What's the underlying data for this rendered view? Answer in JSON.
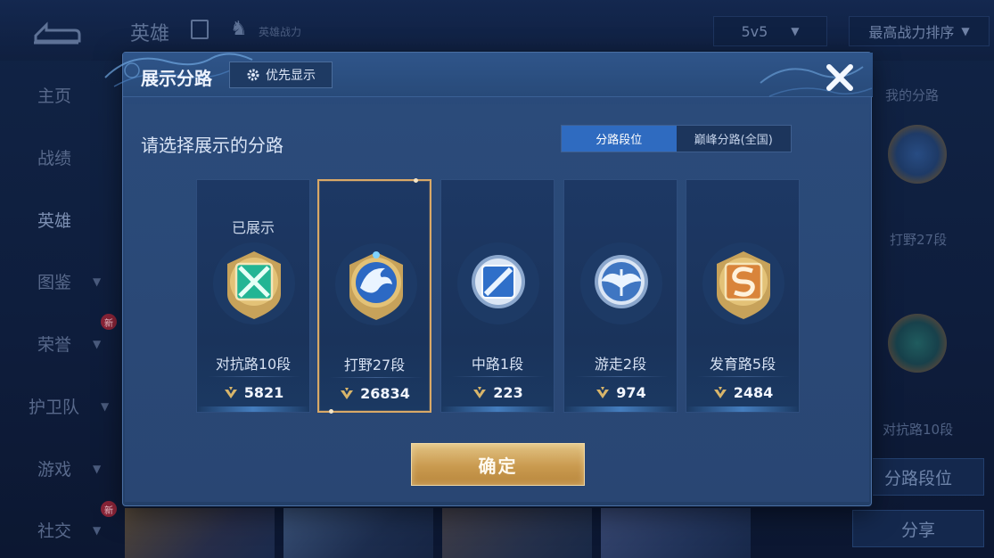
{
  "background": {
    "title": "英雄",
    "subtitle": "英雄战力",
    "mode_select": "5v5",
    "sort_select": "最高战力排序",
    "sidebar": [
      {
        "label": "主页",
        "has_chevron": false,
        "is_new": false
      },
      {
        "label": "战绩",
        "has_chevron": false,
        "is_new": false
      },
      {
        "label": "英雄",
        "has_chevron": false,
        "is_new": false
      },
      {
        "label": "图鉴",
        "has_chevron": true,
        "is_new": false
      },
      {
        "label": "荣誉",
        "has_chevron": true,
        "is_new": true
      },
      {
        "label": "护卫队",
        "has_chevron": true,
        "is_new": false
      },
      {
        "label": "游戏",
        "has_chevron": true,
        "is_new": false
      },
      {
        "label": "社交",
        "has_chevron": true,
        "is_new": true
      }
    ],
    "new_tag": "新",
    "right_panel": {
      "header": "我的分路",
      "lane1_label": "打野27段",
      "lane2_label": "对抗路10段",
      "lane_rank_button": "分路段位",
      "share_button": "分享"
    }
  },
  "modal": {
    "title": "展示分路",
    "priority_button": "优先显示",
    "section_title": "请选择展示的分路",
    "tabs": [
      {
        "label": "分路段位",
        "active": true
      },
      {
        "label": "巅峰分路(全国)",
        "active": false
      }
    ],
    "cards": [
      {
        "shown_label": "已展示",
        "name": "对抗路10段",
        "power": "5821",
        "selected": false,
        "badge": "clash-lane",
        "badge_color": "#2fb79a"
      },
      {
        "shown_label": "",
        "name": "打野27段",
        "power": "26834",
        "selected": true,
        "badge": "jungle",
        "badge_color": "#2f6fc9"
      },
      {
        "shown_label": "",
        "name": "中路1段",
        "power": "223",
        "selected": false,
        "badge": "mid-lane",
        "badge_color": "#3c7bd1"
      },
      {
        "shown_label": "",
        "name": "游走2段",
        "power": "974",
        "selected": false,
        "badge": "roam",
        "badge_color": "#4a7cc4"
      },
      {
        "shown_label": "",
        "name": "发育路5段",
        "power": "2484",
        "selected": false,
        "badge": "farm-lane",
        "badge_color": "#d9843a"
      }
    ],
    "confirm_button": "确定"
  },
  "colors": {
    "accent_gold": "#d9a967",
    "tab_active": "#2f6bc0",
    "modal_bg": "#284673"
  }
}
